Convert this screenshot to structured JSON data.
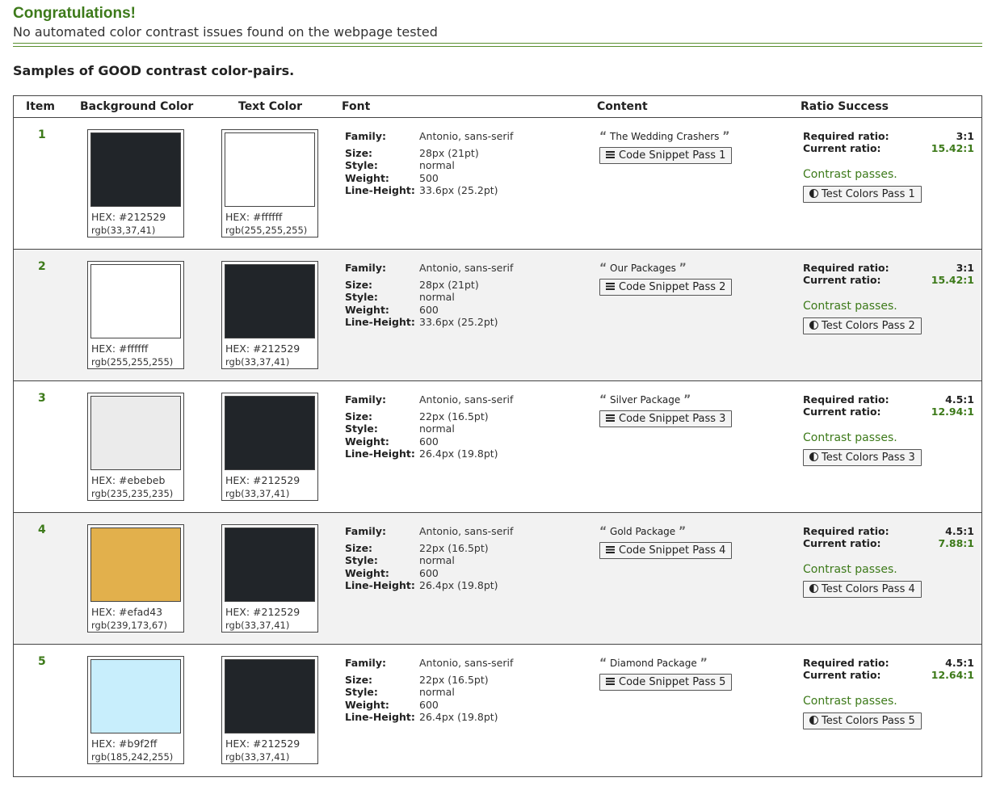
{
  "header": {
    "title": "Congratulations!",
    "subtitle": "No automated color contrast issues found on the webpage tested",
    "section_title": "Samples of GOOD contrast color-pairs."
  },
  "table": {
    "columns": [
      "Item",
      "Background Color",
      "Text Color",
      "Font",
      "Content",
      "Ratio Success"
    ],
    "font_labels": {
      "family": "Family:",
      "size": "Size:",
      "style": "Style:",
      "weight": "Weight:",
      "line_height": "Line-Height:"
    },
    "ratio_labels": {
      "required": "Required ratio:",
      "current": "Current ratio:"
    },
    "passes_text": "Contrast passes.",
    "rows": [
      {
        "item": "1",
        "bg_hex": "HEX: #212529",
        "bg_rgb": "rgb(33,37,41)",
        "bg_color": "#212529",
        "fg_hex": "HEX: #ffffff",
        "fg_rgb": "rgb(255,255,255)",
        "fg_color": "#ffffff",
        "family": "Antonio, sans-serif",
        "size": "28px (21pt)",
        "style": "normal",
        "weight": "500",
        "line_height": "33.6px (25.2pt)",
        "content": "The Wedding Crashers",
        "snippet": "Code Snippet Pass 1",
        "required": "3:1",
        "current": "15.42:1",
        "test": "Test Colors Pass 1"
      },
      {
        "item": "2",
        "bg_hex": "HEX: #ffffff",
        "bg_rgb": "rgb(255,255,255)",
        "bg_color": "#ffffff",
        "fg_hex": "HEX: #212529",
        "fg_rgb": "rgb(33,37,41)",
        "fg_color": "#212529",
        "family": "Antonio, sans-serif",
        "size": "28px (21pt)",
        "style": "normal",
        "weight": "600",
        "line_height": "33.6px (25.2pt)",
        "content": "Our Packages",
        "snippet": "Code Snippet Pass 2",
        "required": "3:1",
        "current": "15.42:1",
        "test": "Test Colors Pass 2"
      },
      {
        "item": "3",
        "bg_hex": "HEX: #ebebeb",
        "bg_rgb": "rgb(235,235,235)",
        "bg_color": "#ebebeb",
        "fg_hex": "HEX: #212529",
        "fg_rgb": "rgb(33,37,41)",
        "fg_color": "#212529",
        "family": "Antonio, sans-serif",
        "size": "22px (16.5pt)",
        "style": "normal",
        "weight": "600",
        "line_height": "26.4px (19.8pt)",
        "content": "Silver Package",
        "snippet": "Code Snippet Pass 3",
        "required": "4.5:1",
        "current": "12.94:1",
        "test": "Test Colors Pass 3"
      },
      {
        "item": "4",
        "bg_hex": "HEX: #efad43",
        "bg_rgb": "rgb(239,173,67)",
        "bg_color": "#e2b04c",
        "fg_hex": "HEX: #212529",
        "fg_rgb": "rgb(33,37,41)",
        "fg_color": "#212529",
        "family": "Antonio, sans-serif",
        "size": "22px (16.5pt)",
        "style": "normal",
        "weight": "600",
        "line_height": "26.4px (19.8pt)",
        "content": "Gold Package",
        "snippet": "Code Snippet Pass 4",
        "required": "4.5:1",
        "current": "7.88:1",
        "test": "Test Colors Pass 4"
      },
      {
        "item": "5",
        "bg_hex": "HEX: #b9f2ff",
        "bg_rgb": "rgb(185,242,255)",
        "bg_color": "#c8eefc",
        "fg_hex": "HEX: #212529",
        "fg_rgb": "rgb(33,37,41)",
        "fg_color": "#212529",
        "family": "Antonio, sans-serif",
        "size": "22px (16.5pt)",
        "style": "normal",
        "weight": "600",
        "line_height": "26.4px (19.8pt)",
        "content": "Diamond Package",
        "snippet": "Code Snippet Pass 5",
        "required": "4.5:1",
        "current": "12.64:1",
        "test": "Test Colors Pass 5"
      }
    ]
  },
  "colors": {
    "accent_green": "#3d7a1a",
    "border": "#444444",
    "alt_row": "#f2f2f2"
  },
  "icons": {
    "quote_open": "quote-open-icon",
    "quote_close": "quote-close-icon",
    "snippet": "lines-icon",
    "test": "contrast-icon"
  }
}
